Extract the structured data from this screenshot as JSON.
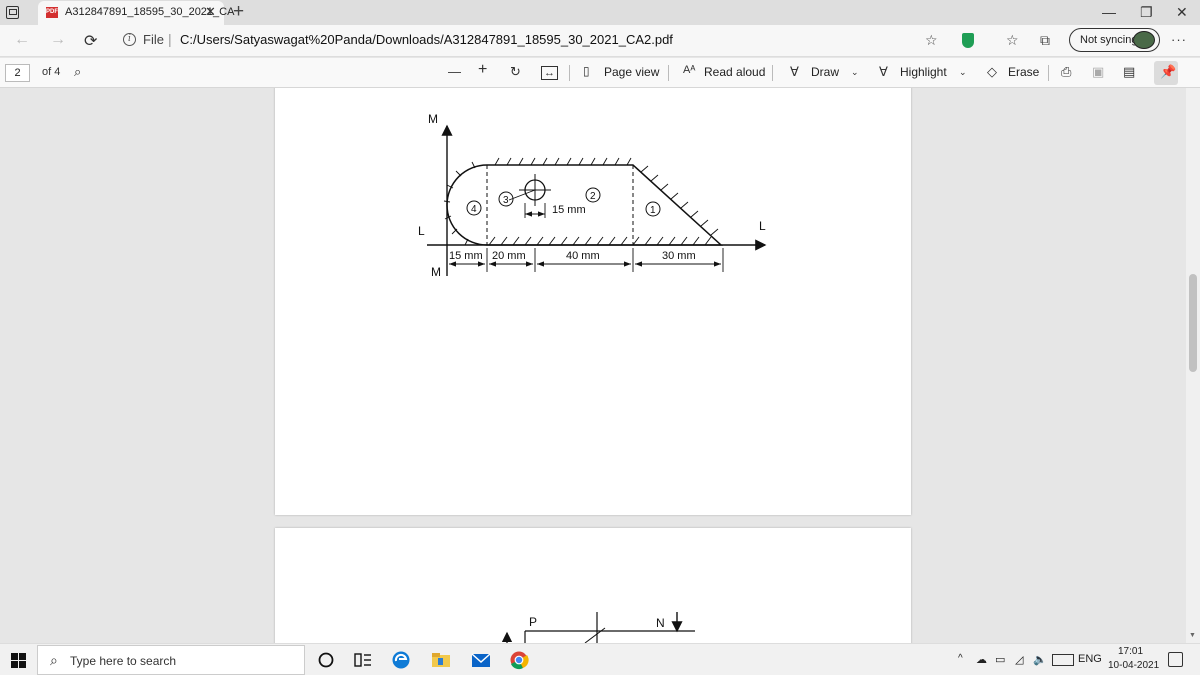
{
  "browser": {
    "tab_title": "A312847891_18595_30_2021_CA",
    "tab_file_badge": "PDF",
    "url_scheme_label": "File",
    "url": "C:/Users/Satyaswagat%20Panda/Downloads/A312847891_18595_30_2021_CA2.pdf",
    "sync_label": "Not syncing",
    "more_label": "···"
  },
  "pdf_toolbar": {
    "current_page": "2",
    "page_count_label": "of 4",
    "zoom_out": "—",
    "zoom_in": "+",
    "page_view": "Page view",
    "read_aloud": "Read aloud",
    "draw": "Draw",
    "highlight": "Highlight",
    "erase": "Erase"
  },
  "diagram1": {
    "axis_top_label": "M",
    "axis_bottom_label": "M",
    "baseline_left_label": "L",
    "baseline_right_label": "L",
    "circle_labels": [
      "1",
      "2",
      "3",
      "4"
    ],
    "dim_15mm_inner": "15 mm",
    "dims": [
      "15 mm",
      "20 mm",
      "40 mm",
      "30 mm"
    ]
  },
  "diagram2": {
    "label_p": "P",
    "label_n": "N"
  },
  "taskbar": {
    "search_placeholder": "Type here to search",
    "language": "ENG",
    "time": "17:01",
    "date": "10-04-2021"
  },
  "colors": {
    "shield_green": "#1f9e55",
    "pdf_red": "#d32f2f",
    "edge_blue": "#0f7bd6"
  }
}
